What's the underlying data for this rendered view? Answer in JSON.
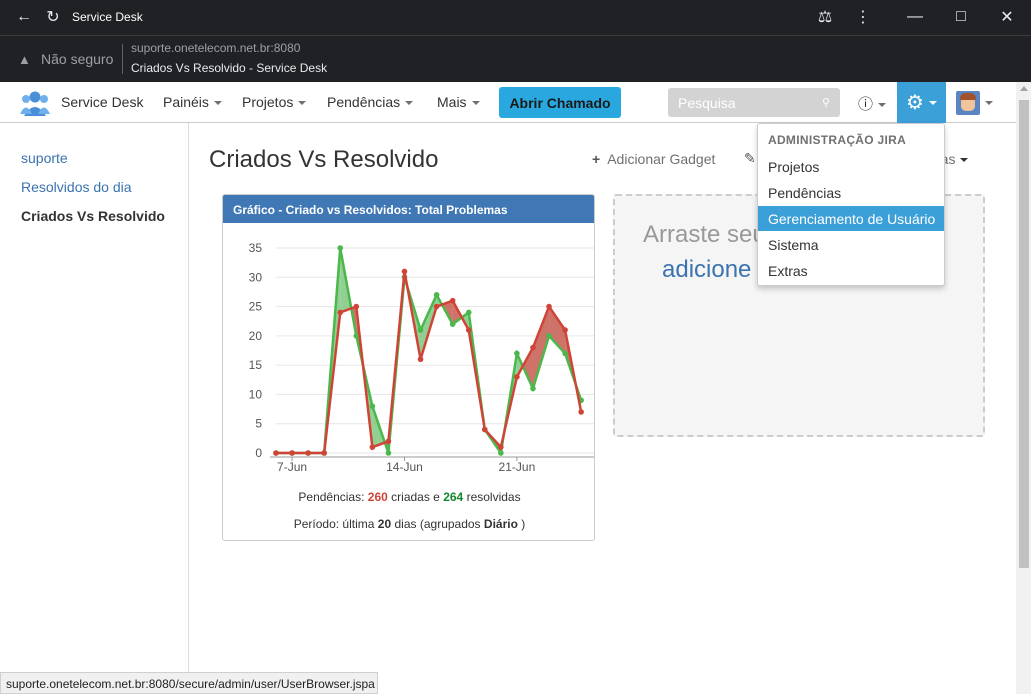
{
  "browser": {
    "window_title": "Service Desk",
    "security_label": "Não seguro",
    "url": "suporte.onetelecom.net.br:8080",
    "page_title": "Criados Vs Resolvido - Service Desk",
    "status_url": "suporte.onetelecom.net.br:8080/secure/admin/user/UserBrowser.jspa"
  },
  "header": {
    "brand": "Service Desk",
    "nav": [
      "Painéis",
      "Projetos",
      "Pendências",
      "Mais"
    ],
    "create_label": "Abrir Chamado",
    "search_placeholder": "Pesquisa",
    "accent": "#3b9fd8"
  },
  "sidebar": {
    "items": [
      {
        "label": "suporte"
      },
      {
        "label": "Resolvidos do dia"
      },
      {
        "label": "Criados Vs Resolvido"
      }
    ]
  },
  "main": {
    "title": "Criados Vs Resolvido",
    "add_gadget": "Adicionar Gadget",
    "tools_label": "ntas",
    "dropzone_line1": "Arraste seu gadget aqui ou",
    "dropzone_line2": "adicione"
  },
  "gadget": {
    "title": "Gráfico - Criado vs Resolvidos: Total Problemas",
    "summary_prefix": "Pendências:",
    "created_count": "260",
    "summary_mid": "criadas e",
    "resolved_count": "264",
    "summary_suffix": "resolvidas",
    "period_prefix": "Período: última",
    "period_days": "20",
    "period_mid": "dias (agrupados",
    "period_group": "Diário",
    "period_suffix": ")"
  },
  "admin_menu": {
    "heading": "ADMINISTRAÇÃO JIRA",
    "items": [
      "Projetos",
      "Pendências",
      "Gerenciamento de Usuário",
      "Sistema",
      "Extras"
    ],
    "selected_index": 2
  },
  "chart_data": {
    "type": "area",
    "title": "",
    "xlabel": "",
    "ylabel": "",
    "ylim": [
      0,
      35
    ],
    "yticks": [
      0,
      5,
      10,
      15,
      20,
      25,
      30,
      35
    ],
    "xtick_labels": [
      "7-Jun",
      "14-Jun",
      "21-Jun"
    ],
    "xtick_index": [
      1,
      8,
      15
    ],
    "x": [
      1,
      2,
      3,
      4,
      5,
      6,
      7,
      8,
      9,
      10,
      11,
      12,
      13,
      14,
      15,
      16,
      17,
      18,
      19,
      20
    ],
    "colors": {
      "created": "#d04437",
      "resolved": "#4bb84b"
    },
    "series": [
      {
        "key": "created",
        "values": [
          0,
          0,
          0,
          0,
          24,
          25,
          1,
          2,
          31,
          16,
          25,
          26,
          21,
          4,
          1,
          13,
          18,
          25,
          21,
          7
        ]
      },
      {
        "key": "resolved",
        "values": [
          0,
          0,
          0,
          0,
          35,
          20,
          8,
          0,
          30,
          21,
          27,
          22,
          24,
          4,
          0,
          17,
          11,
          20,
          17,
          9
        ]
      }
    ],
    "x_start": 0,
    "x_end": 19.8
  }
}
